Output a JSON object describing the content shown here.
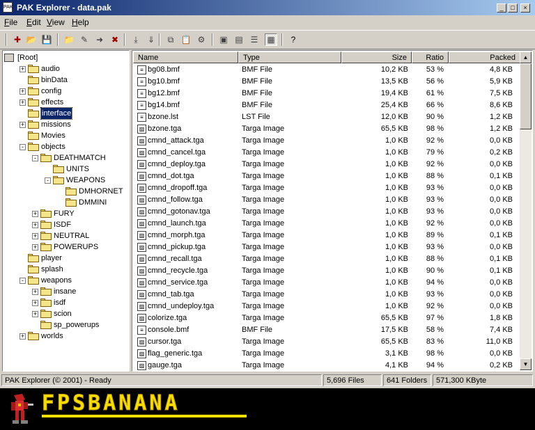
{
  "window": {
    "title": "PAK Explorer - data.pak",
    "controls": [
      "_",
      "□",
      "×"
    ]
  },
  "menu": [
    {
      "key": "F",
      "rest": "ile"
    },
    {
      "key": "E",
      "rest": "dit"
    },
    {
      "key": "V",
      "rest": "iew"
    },
    {
      "key": "H",
      "rest": "elp"
    }
  ],
  "toolbar": {
    "icons": [
      "new-pak-icon",
      "open-icon",
      "save-icon",
      "new-folder-icon",
      "rename-icon",
      "move-icon",
      "delete-icon",
      "extract-icon",
      "extract-all-icon",
      "copy-icon",
      "paste-icon",
      "properties-icon",
      "large-icons-view-icon",
      "small-icons-view-icon",
      "list-view-icon",
      "details-view-icon",
      "help-icon"
    ]
  },
  "tree": [
    {
      "label": "[Root]",
      "depth": 0,
      "exp": "-",
      "root": true
    },
    {
      "label": "audio",
      "depth": 1,
      "exp": "+"
    },
    {
      "label": "binData",
      "depth": 1,
      "exp": ""
    },
    {
      "label": "config",
      "depth": 1,
      "exp": "+"
    },
    {
      "label": "effects",
      "depth": 1,
      "exp": "+"
    },
    {
      "label": "interface",
      "depth": 1,
      "exp": "",
      "selected": true
    },
    {
      "label": "missions",
      "depth": 1,
      "exp": "+"
    },
    {
      "label": "Movies",
      "depth": 1,
      "exp": ""
    },
    {
      "label": "objects",
      "depth": 1,
      "exp": "-"
    },
    {
      "label": "DEATHMATCH",
      "depth": 2,
      "exp": "-"
    },
    {
      "label": "UNITS",
      "depth": 3,
      "exp": ""
    },
    {
      "label": "WEAPONS",
      "depth": 3,
      "exp": "-"
    },
    {
      "label": "DMHORNET",
      "depth": 4,
      "exp": ""
    },
    {
      "label": "DMMINI",
      "depth": 4,
      "exp": ""
    },
    {
      "label": "FURY",
      "depth": 2,
      "exp": "+"
    },
    {
      "label": "ISDF",
      "depth": 2,
      "exp": "+"
    },
    {
      "label": "NEUTRAL",
      "depth": 2,
      "exp": "+"
    },
    {
      "label": "POWERUPS",
      "depth": 2,
      "exp": "+"
    },
    {
      "label": "player",
      "depth": 1,
      "exp": ""
    },
    {
      "label": "splash",
      "depth": 1,
      "exp": ""
    },
    {
      "label": "weapons",
      "depth": 1,
      "exp": "-"
    },
    {
      "label": "insane",
      "depth": 2,
      "exp": "+"
    },
    {
      "label": "isdf",
      "depth": 2,
      "exp": "+"
    },
    {
      "label": "scion",
      "depth": 2,
      "exp": "+"
    },
    {
      "label": "sp_powerups",
      "depth": 2,
      "exp": ""
    },
    {
      "label": "worlds",
      "depth": 1,
      "exp": "+"
    }
  ],
  "columns": [
    "Name",
    "Type",
    "Size",
    "Ratio",
    "Packed"
  ],
  "files": [
    [
      "bg08.bmf",
      "BMF File",
      "10,2 KB",
      "53 %",
      "4,8 KB"
    ],
    [
      "bg10.bmf",
      "BMF File",
      "13,5 KB",
      "56 %",
      "5,9 KB"
    ],
    [
      "bg12.bmf",
      "BMF File",
      "19,4 KB",
      "61 %",
      "7,5 KB"
    ],
    [
      "bg14.bmf",
      "BMF File",
      "25,4 KB",
      "66 %",
      "8,6 KB"
    ],
    [
      "bzone.lst",
      "LST File",
      "12,0 KB",
      "90 %",
      "1,2 KB"
    ],
    [
      "bzone.tga",
      "Targa Image",
      "65,5 KB",
      "98 %",
      "1,2 KB"
    ],
    [
      "cmnd_attack.tga",
      "Targa Image",
      "1,0 KB",
      "92 %",
      "0,0 KB"
    ],
    [
      "cmnd_cancel.tga",
      "Targa Image",
      "1,0 KB",
      "79 %",
      "0,2 KB"
    ],
    [
      "cmnd_deploy.tga",
      "Targa Image",
      "1,0 KB",
      "92 %",
      "0,0 KB"
    ],
    [
      "cmnd_dot.tga",
      "Targa Image",
      "1,0 KB",
      "88 %",
      "0,1 KB"
    ],
    [
      "cmnd_dropoff.tga",
      "Targa Image",
      "1,0 KB",
      "93 %",
      "0,0 KB"
    ],
    [
      "cmnd_follow.tga",
      "Targa Image",
      "1,0 KB",
      "93 %",
      "0,0 KB"
    ],
    [
      "cmnd_gotonav.tga",
      "Targa Image",
      "1,0 KB",
      "93 %",
      "0,0 KB"
    ],
    [
      "cmnd_launch.tga",
      "Targa Image",
      "1,0 KB",
      "92 %",
      "0,0 KB"
    ],
    [
      "cmnd_morph.tga",
      "Targa Image",
      "1,0 KB",
      "89 %",
      "0,1 KB"
    ],
    [
      "cmnd_pickup.tga",
      "Targa Image",
      "1,0 KB",
      "93 %",
      "0,0 KB"
    ],
    [
      "cmnd_recall.tga",
      "Targa Image",
      "1,0 KB",
      "88 %",
      "0,1 KB"
    ],
    [
      "cmnd_recycle.tga",
      "Targa Image",
      "1,0 KB",
      "90 %",
      "0,1 KB"
    ],
    [
      "cmnd_service.tga",
      "Targa Image",
      "1,0 KB",
      "94 %",
      "0,0 KB"
    ],
    [
      "cmnd_tab.tga",
      "Targa Image",
      "1,0 KB",
      "93 %",
      "0,0 KB"
    ],
    [
      "cmnd_undeploy.tga",
      "Targa Image",
      "1,0 KB",
      "92 %",
      "0,0 KB"
    ],
    [
      "colorize.tga",
      "Targa Image",
      "65,5 KB",
      "97 %",
      "1,8 KB"
    ],
    [
      "console.bmf",
      "BMF File",
      "17,5 KB",
      "58 %",
      "7,4 KB"
    ],
    [
      "cursor.tga",
      "Targa Image",
      "65,5 KB",
      "83 %",
      "11,0 KB"
    ],
    [
      "flag_generic.tga",
      "Targa Image",
      "3,1 KB",
      "98 %",
      "0,0 KB"
    ],
    [
      "gauge.tga",
      "Targa Image",
      "4,1 KB",
      "94 %",
      "0,2 KB"
    ]
  ],
  "status": {
    "ready": "PAK Explorer (© 2001) - Ready",
    "files": "5,696 Files",
    "folders": "641 Folders",
    "size": "571,300 KByte"
  },
  "banner": {
    "logo": "FPSBANANA"
  },
  "colors": {
    "title_start": "#0a246a",
    "title_end": "#a6caf0",
    "logo": "#f8e000",
    "selection": "#0a246a"
  }
}
